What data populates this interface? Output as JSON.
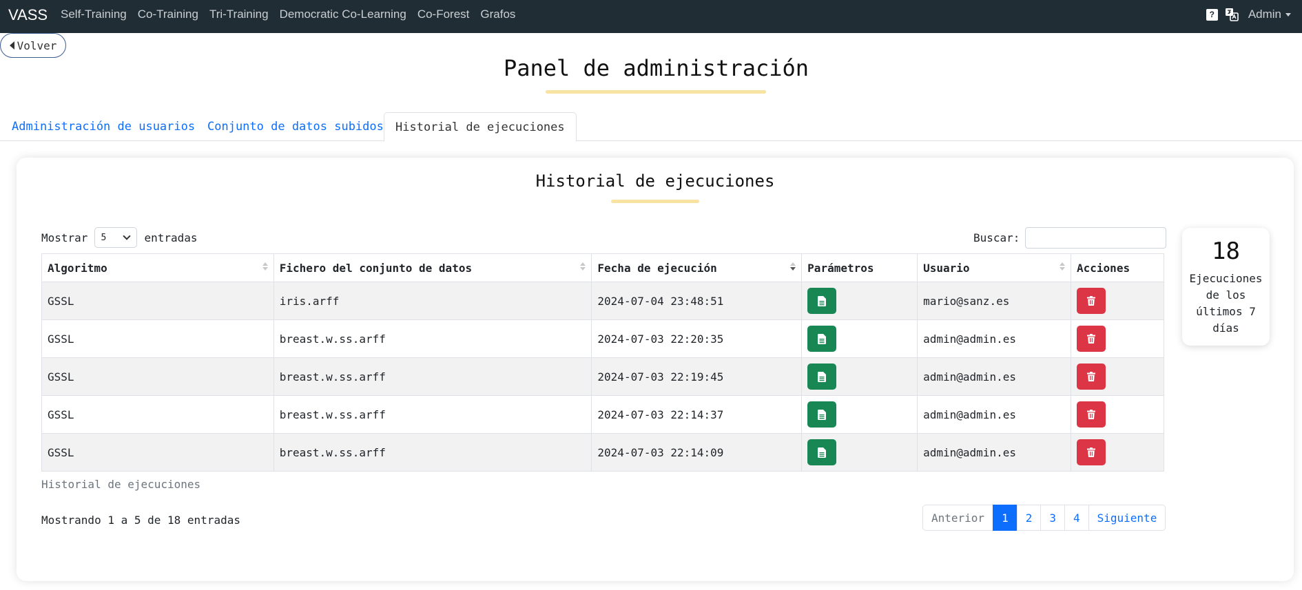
{
  "navbar": {
    "brand": "VASS",
    "links": [
      "Self-Training",
      "Co-Training",
      "Tri-Training",
      "Democratic Co-Learning",
      "Co-Forest",
      "Grafos"
    ],
    "help_icon": "?",
    "user_menu": "Admin"
  },
  "back_button": "Volver",
  "page_title": "Panel de administración",
  "tabs": [
    "Administración de usuarios",
    "Conjunto de datos subidos",
    "Historial de ejecuciones"
  ],
  "active_tab": "Historial de ejecuciones",
  "card": {
    "title": "Historial de ejecuciones",
    "length_prefix": "Mostrar",
    "length_value": "5",
    "length_suffix": "entradas",
    "search_label": "Buscar:",
    "search_value": "",
    "columns": [
      "Algoritmo",
      "Fichero del conjunto de datos",
      "Fecha de ejecución",
      "Parámetros",
      "Usuario",
      "Acciones"
    ],
    "rows": [
      {
        "algorithm": "GSSL",
        "file": "iris.arff",
        "date": "2024-07-04 23:48:51",
        "user": "mario@sanz.es"
      },
      {
        "algorithm": "GSSL",
        "file": "breast.w.ss.arff",
        "date": "2024-07-03 22:20:35",
        "user": "admin@admin.es"
      },
      {
        "algorithm": "GSSL",
        "file": "breast.w.ss.arff",
        "date": "2024-07-03 22:19:45",
        "user": "admin@admin.es"
      },
      {
        "algorithm": "GSSL",
        "file": "breast.w.ss.arff",
        "date": "2024-07-03 22:14:37",
        "user": "admin@admin.es"
      },
      {
        "algorithm": "GSSL",
        "file": "breast.w.ss.arff",
        "date": "2024-07-03 22:14:09",
        "user": "admin@admin.es"
      }
    ],
    "caption": "Historial de ejecuciones",
    "info": "Mostrando 1 a 5 de 18 entradas",
    "pagination": {
      "previous": "Anterior",
      "pages": [
        "1",
        "2",
        "3",
        "4"
      ],
      "current": "1",
      "next": "Siguiente"
    }
  },
  "stat": {
    "value": "18",
    "label": "Ejecuciones de los últimos 7 días"
  },
  "colors": {
    "navbar_bg": "#212d35",
    "accent": "#f8e3a3",
    "link": "#0d6efd",
    "params_button": "#198754",
    "delete_button": "#dc3545"
  },
  "icons": {
    "params_button": "file-text-icon",
    "delete_button": "trash-icon",
    "back_button": "caret-left-icon",
    "language": "translate-icon",
    "help": "question-icon"
  }
}
